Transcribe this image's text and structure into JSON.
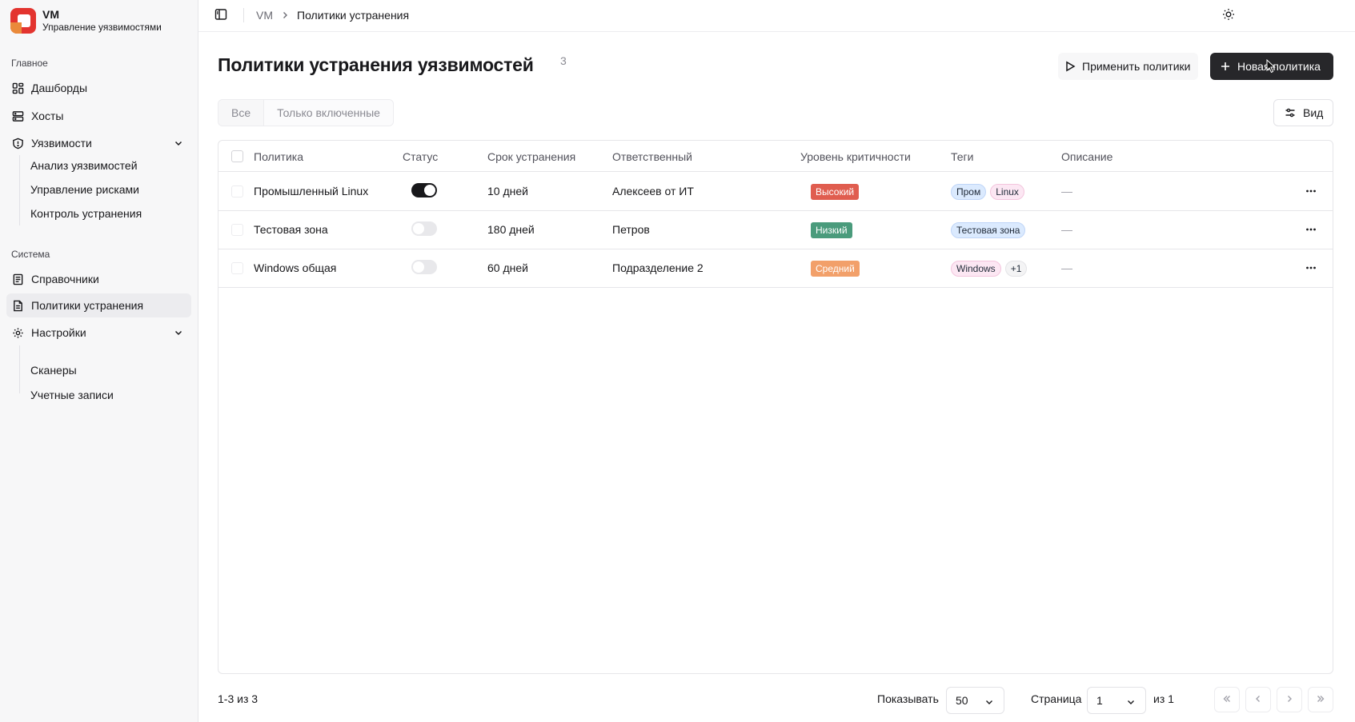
{
  "app": {
    "title": "VM",
    "subtitle": "Управление уязвимостями",
    "brand_color": "#e3342f"
  },
  "sidebar": {
    "sections": [
      {
        "label": "Главное"
      },
      {
        "label": "Система"
      }
    ],
    "main_items": [
      {
        "label": "Дашборды",
        "icon": "dashboard-icon"
      },
      {
        "label": "Хосты",
        "icon": "server-icon"
      },
      {
        "label": "Уязвимости",
        "icon": "shield-icon",
        "expanded": true
      }
    ],
    "vuln_sub": [
      {
        "label": "Анализ уязвимостей"
      },
      {
        "label": "Управление рисками"
      },
      {
        "label": "Контроль устранения"
      }
    ],
    "system_items": [
      {
        "label": "Справочники",
        "icon": "book-icon"
      },
      {
        "label": "Политики устранения",
        "icon": "file-icon",
        "active": true
      },
      {
        "label": "Настройки",
        "icon": "gear-icon",
        "expanded": true
      }
    ],
    "settings_sub": [
      {
        "label": "Сканеры"
      },
      {
        "label": "Учетные записи"
      }
    ]
  },
  "breadcrumb": {
    "root": "VM",
    "current": "Политики устранения"
  },
  "page": {
    "title": "Политики устранения уязвимостей",
    "count": "3",
    "apply_label": "Применить политики",
    "new_label": "Новая политика",
    "view_label": "Вид"
  },
  "filters": {
    "all": "Все",
    "enabled_only": "Только включенные",
    "selected": "Все"
  },
  "table": {
    "columns": [
      "Политика",
      "Статус",
      "Срок устранения",
      "Ответственный",
      "Уровень критичности",
      "Теги",
      "Описание"
    ],
    "rows": [
      {
        "name": "Промышленный Linux",
        "enabled": true,
        "deadline": "10 дней",
        "owner": "Алексеев от ИТ",
        "severity": "Высокий",
        "severity_color": "#e05d4f",
        "tags": [
          {
            "label": "Пром",
            "color": "blue"
          },
          {
            "label": "Linux",
            "color": "pink"
          }
        ],
        "description": "—"
      },
      {
        "name": "Тестовая зона",
        "enabled": false,
        "deadline": "180 дней",
        "owner": "Петров",
        "severity": "Низкий",
        "severity_color": "#4a9b7c",
        "tags": [
          {
            "label": "Тестовая зона",
            "color": "blue"
          }
        ],
        "description": "—"
      },
      {
        "name": "Windows общая",
        "enabled": false,
        "deadline": "60 дней",
        "owner": "Подразделение 2",
        "severity": "Средний",
        "severity_color": "#f2a06a",
        "tags": [
          {
            "label": "Windows",
            "color": "pink"
          },
          {
            "label": "+1",
            "color": "gray"
          }
        ],
        "description": "—"
      }
    ]
  },
  "footer": {
    "range": "1-3 из 3",
    "show_label": "Показывать",
    "page_size": "50",
    "page_label": "Страница",
    "page": "1",
    "of_label": "из 1"
  }
}
